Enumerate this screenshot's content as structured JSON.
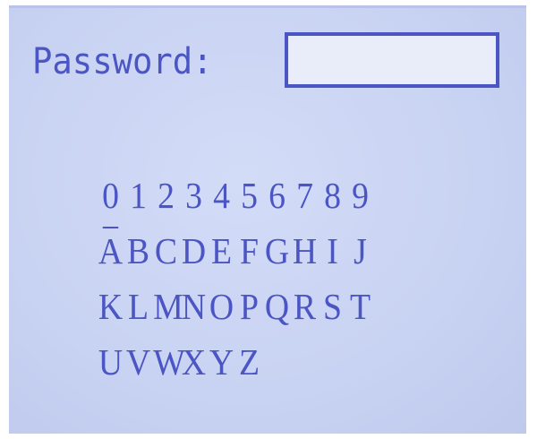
{
  "screen": {
    "prompt_label": "Password:",
    "password_value": "",
    "text_color": "#4b55c4",
    "background_color": "#c9d3f3"
  },
  "keypad": {
    "rows": [
      [
        "0",
        "1",
        "2",
        "3",
        "4",
        "5",
        "6",
        "7",
        "8",
        "9"
      ],
      [
        "A",
        "B",
        "C",
        "D",
        "E",
        "F",
        "G",
        "H",
        "I",
        "J"
      ],
      [
        "K",
        "L",
        "M",
        "N",
        "O",
        "P",
        "Q",
        "R",
        "S",
        "T"
      ],
      [
        "U",
        "V",
        "W",
        "X",
        "Y",
        "Z"
      ]
    ],
    "selected": "A"
  }
}
